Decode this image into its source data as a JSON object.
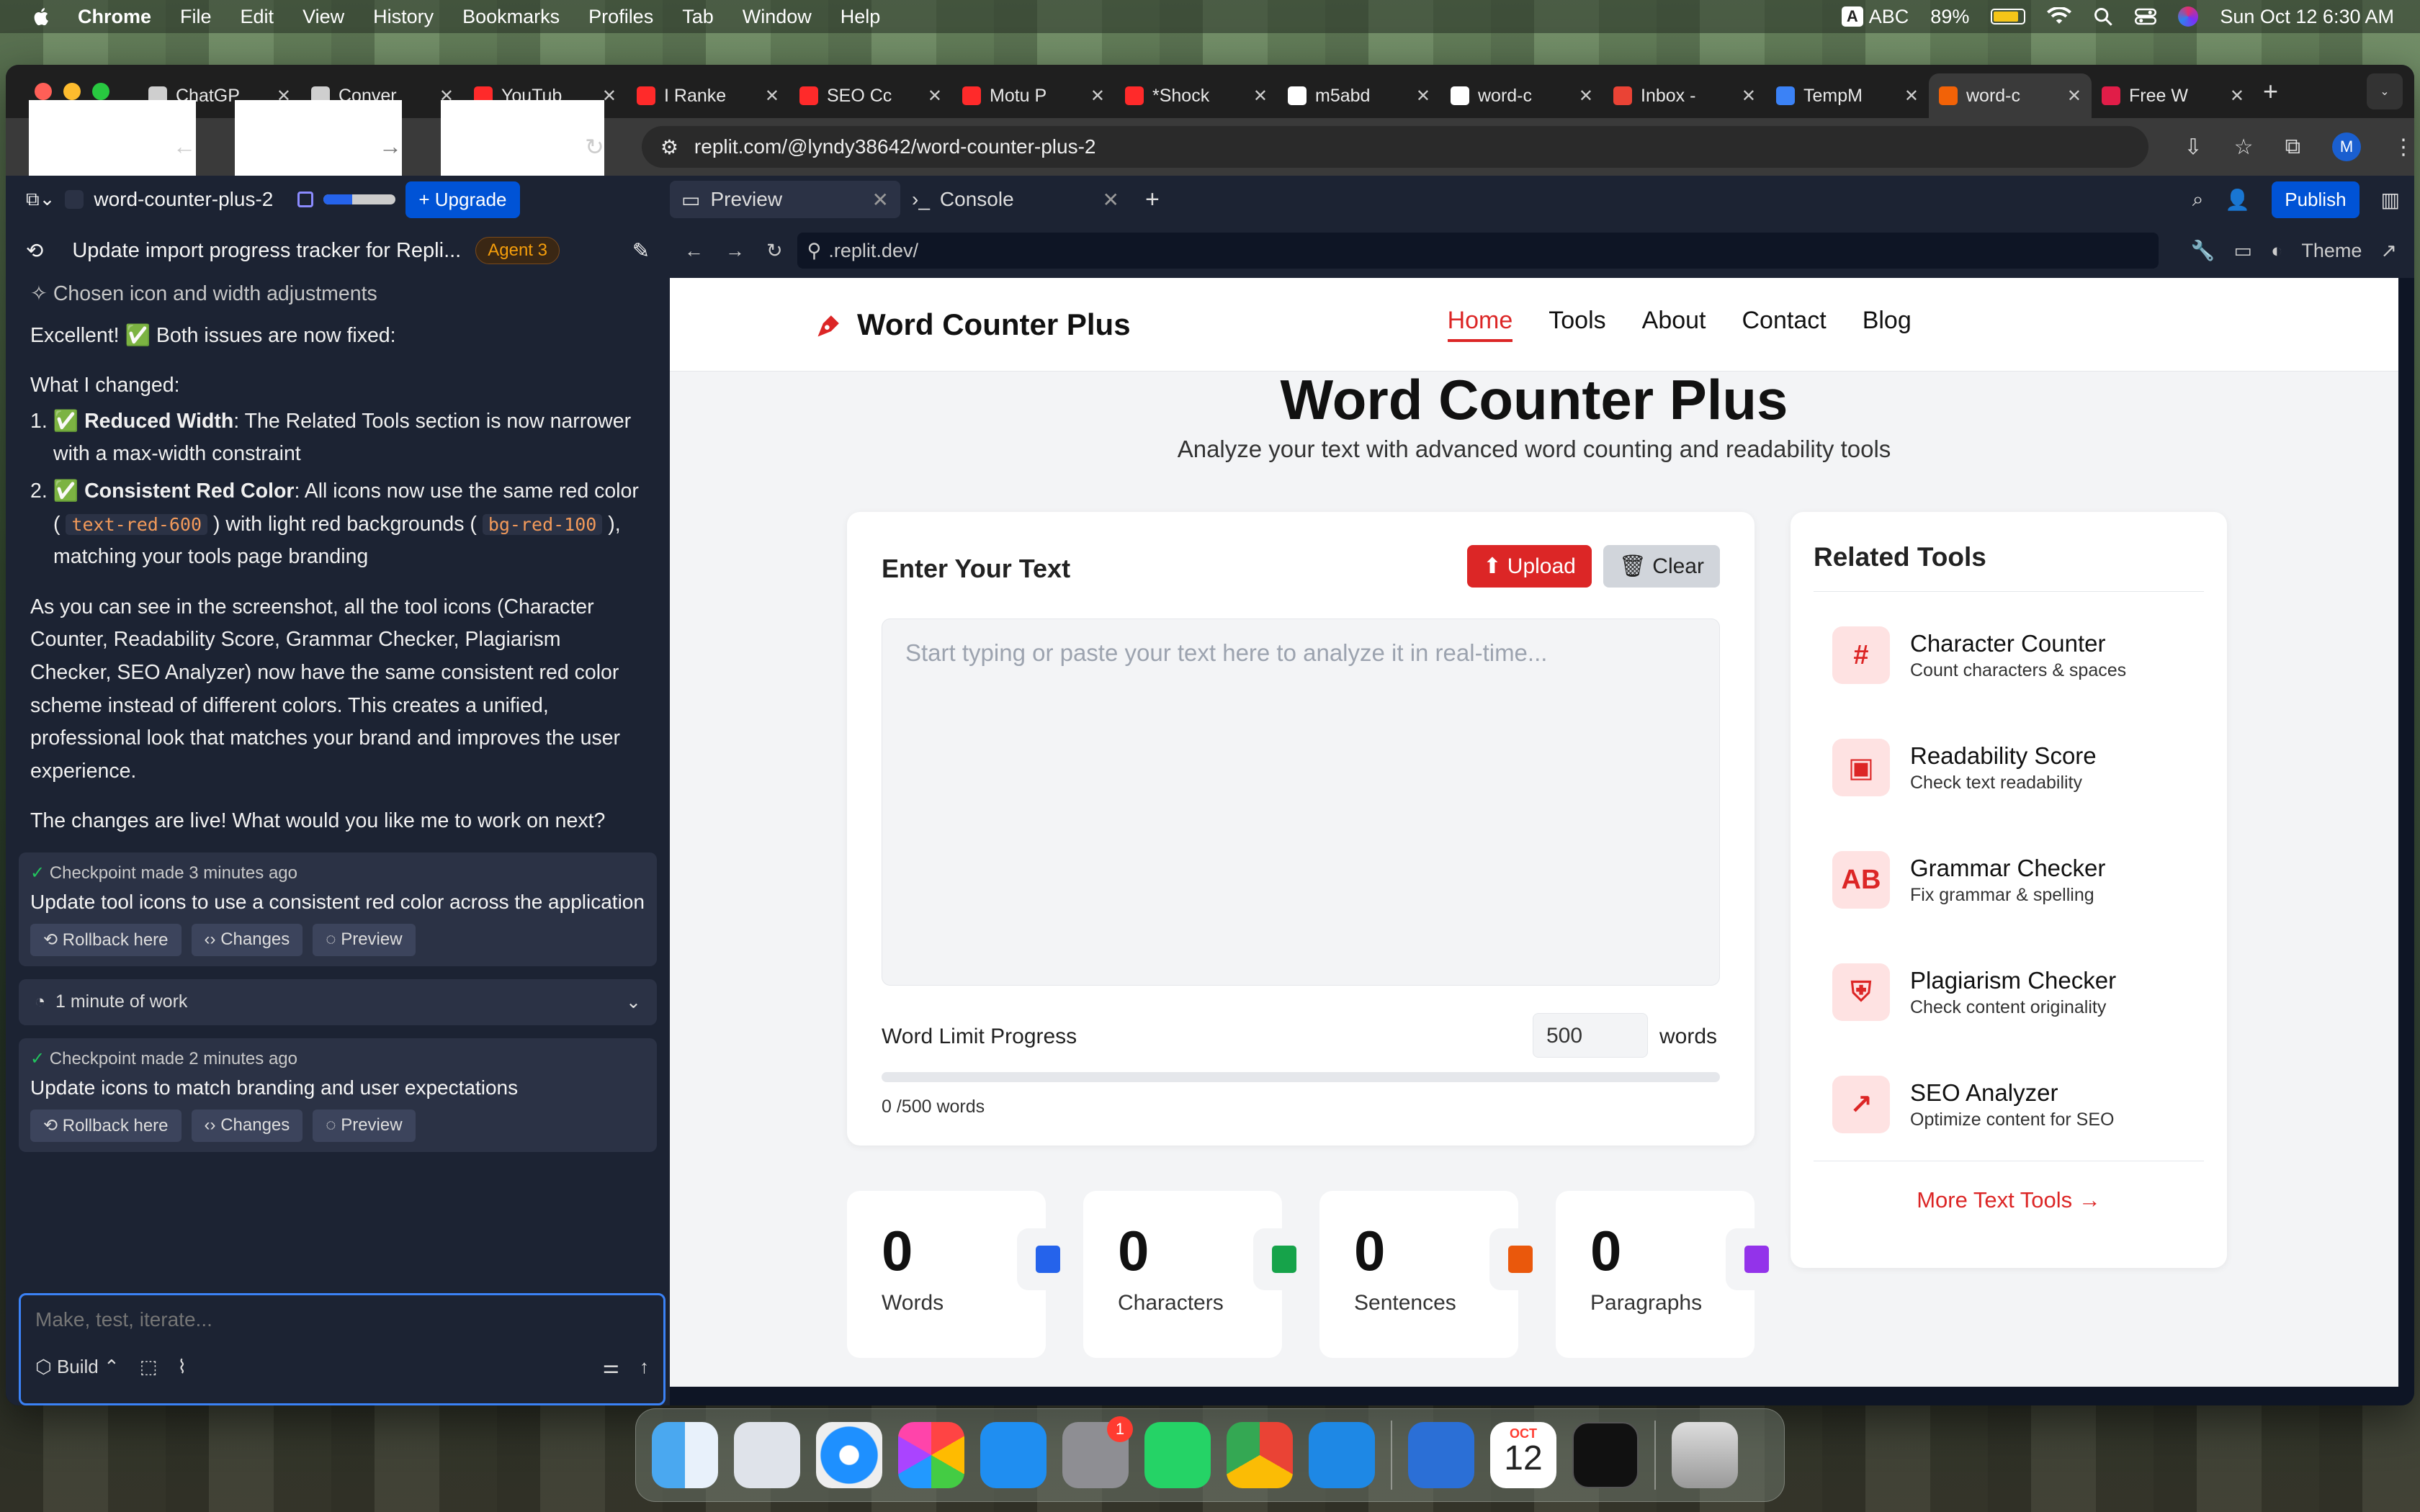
{
  "menubar": {
    "app": "Chrome",
    "items": [
      "File",
      "Edit",
      "View",
      "History",
      "Bookmarks",
      "Profiles",
      "Tab",
      "Window",
      "Help"
    ],
    "input_badge": "A",
    "input_label": "ABC",
    "battery": "89%",
    "datetime": "Sun Oct 12  6:30 AM"
  },
  "tabs": [
    {
      "title": "ChatGP",
      "color": "#cfcfcf"
    },
    {
      "title": "Conver",
      "color": "#cfcfcf"
    },
    {
      "title": "YouTub",
      "color": "#ff2a2a"
    },
    {
      "title": "I Ranke",
      "color": "#ff2a2a"
    },
    {
      "title": "SEO Cc",
      "color": "#ff2a2a"
    },
    {
      "title": "Motu P",
      "color": "#ff2a2a"
    },
    {
      "title": "*Shock",
      "color": "#ff2a2a"
    },
    {
      "title": "m5abd",
      "color": "#ffffff"
    },
    {
      "title": "word-c",
      "color": "#ffffff"
    },
    {
      "title": "Inbox -",
      "color": "#ea4335"
    },
    {
      "title": "TempM",
      "color": "#3b82f6"
    },
    {
      "title": "word-c",
      "color": "#f26207",
      "active": true
    },
    {
      "title": "Free W",
      "color": "#e11d48"
    }
  ],
  "browser": {
    "url": "replit.com/@lyndy38642/word-counter-plus-2",
    "avatar": "M"
  },
  "replit": {
    "project": "word-counter-plus-2",
    "upgrade": "+ Upgrade",
    "thread_title": "Update import progress tracker for Repli...",
    "agent_badge": "Agent 3",
    "action_note": "Chosen icon and width adjustments",
    "msg_intro": "Excellent! ✅ Both issues are now fixed:",
    "msg_changed": "What I changed:",
    "item1_title": "Reduced Width",
    "item1_text": ": The Related Tools section is now narrower with a max-width constraint",
    "item2_title": "Consistent Red Color",
    "item2_text_a": ": All icons now use the same red color (",
    "item2_code1": "text-red-600",
    "item2_text_b": ") with light red backgrounds (",
    "item2_code2": "bg-red-100",
    "item2_text_c": "), matching your tools page branding",
    "msg_para": "As you can see in the screenshot, all the tool icons (Character Counter, Readability Score, Grammar Checker, Plagiarism Checker, SEO Analyzer) now have the same consistent red color scheme instead of different colors. This creates a unified, professional look that matches your brand and improves the user experience.",
    "msg_ask": "The changes are live! What would you like me to work on next?",
    "checkpoints": [
      {
        "meta": "Checkpoint made 3 minutes ago",
        "title": "Update tool icons to use a consistent red color across the application"
      },
      {
        "meta": "Checkpoint made 2 minutes ago",
        "title": "Update icons to match branding and user expectations"
      }
    ],
    "cp_buttons": {
      "rollback": "Rollback here",
      "changes": "Changes",
      "preview": "Preview"
    },
    "work_label": "1 minute of work",
    "composer_placeholder": "Make, test, iterate...",
    "build_label": "Build",
    "preview_tab": "Preview",
    "console_tab": "Console",
    "publish": "Publish",
    "preview_url": ".replit.dev/",
    "theme": "Theme"
  },
  "site": {
    "brand": "Word Counter Plus",
    "nav": [
      "Home",
      "Tools",
      "About",
      "Contact",
      "Blog"
    ],
    "hero_title": "Word Counter Plus",
    "hero_sub": "Analyze your text with advanced word counting and readability tools",
    "editor_title": "Enter Your Text",
    "upload": "Upload",
    "clear": "Clear",
    "textarea_placeholder": "Start typing or paste your text here to analyze it in real-time...",
    "limit_label": "Word Limit Progress",
    "limit_value": "500",
    "limit_unit": "words",
    "limit_status": "0 /500 words",
    "limit_progress": 0,
    "related_title": "Related Tools",
    "tools": [
      {
        "icon": "#",
        "name": "Character Counter",
        "desc": "Count characters & spaces"
      },
      {
        "icon": "▣",
        "name": "Readability Score",
        "desc": "Check text readability"
      },
      {
        "icon": "AB",
        "name": "Grammar Checker",
        "desc": "Fix grammar & spelling"
      },
      {
        "icon": "⛨",
        "name": "Plagiarism Checker",
        "desc": "Check content originality"
      },
      {
        "icon": "↗",
        "name": "SEO Analyzer",
        "desc": "Optimize content for SEO"
      }
    ],
    "more_tools": "More Text Tools →",
    "stats": [
      {
        "value": "0",
        "label": "Words",
        "color": "#2563eb"
      },
      {
        "value": "0",
        "label": "Characters",
        "color": "#16a34a"
      },
      {
        "value": "0",
        "label": "Sentences",
        "color": "#ea580c"
      },
      {
        "value": "0",
        "label": "Paragraphs",
        "color": "#9333ea"
      }
    ]
  },
  "dock": {
    "calendar_month": "OCT",
    "calendar_day": "12",
    "settings_badge": "1"
  }
}
